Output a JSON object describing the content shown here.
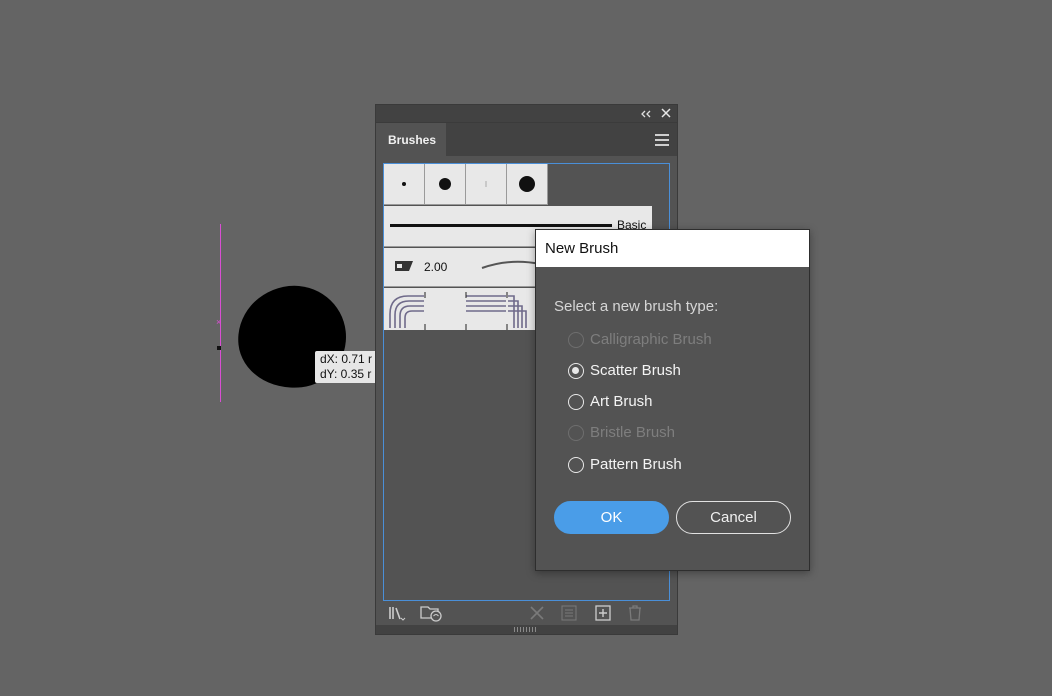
{
  "canvas": {
    "tooltip": {
      "dx": "dX: 0.71 r",
      "dy": "dY: 0.35 r"
    }
  },
  "panel": {
    "title": "Brushes",
    "collapse_icon": "double-chevron-left-icon",
    "close_icon": "close-icon",
    "menu_icon": "hamburger-menu-icon",
    "basic_label": "Basic",
    "calligraphic_size": "2.00",
    "footer_icons": [
      "brush-libraries-icon",
      "creative-cloud-libraries-icon",
      "remove-brush-stroke-icon",
      "brush-options-icon",
      "new-brush-icon",
      "delete-brush-icon"
    ]
  },
  "dialog": {
    "title": "New Brush",
    "prompt": "Select a new brush type:",
    "options": [
      {
        "label": "Calligraphic Brush",
        "enabled": false,
        "checked": false
      },
      {
        "label": "Scatter Brush",
        "enabled": true,
        "checked": true
      },
      {
        "label": "Art Brush",
        "enabled": true,
        "checked": false
      },
      {
        "label": "Bristle Brush",
        "enabled": false,
        "checked": false
      },
      {
        "label": "Pattern Brush",
        "enabled": true,
        "checked": false
      }
    ],
    "ok_label": "OK",
    "cancel_label": "Cancel",
    "ok_color": "#4a9de8"
  }
}
